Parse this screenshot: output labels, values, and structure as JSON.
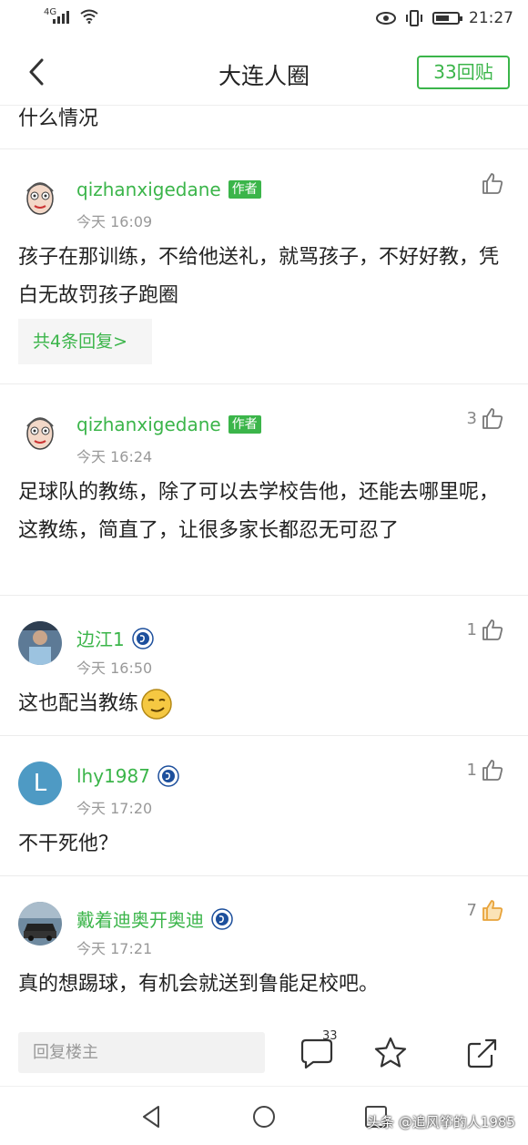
{
  "status_bar": {
    "network": "4G",
    "time": "21:27"
  },
  "header": {
    "title": "大连人圈",
    "reply_count_label": "33回贴"
  },
  "post": {
    "text_tail": "什么情况"
  },
  "comments": [
    {
      "username": "qizhanxigedane",
      "author_tag": "作者",
      "time": "今天 16:09",
      "likes": "",
      "text": "孩子在那训练，不给他送礼，就骂孩子，不好好教，凭白无故罚孩子跑圈",
      "replies_label": "共4条回复>"
    },
    {
      "username": "qizhanxigedane",
      "author_tag": "作者",
      "time": "今天 16:24",
      "likes": "3",
      "text": "足球队的教练，除了可以去学校告他，还能去哪里呢，这教练，简直了，让很多家长都忍无可忍了"
    },
    {
      "username": "边江1",
      "time": "今天 16:50",
      "likes": "1",
      "text": "这也配当教练"
    },
    {
      "username": "lhy1987",
      "avatar_letter": "L",
      "time": "今天 17:20",
      "likes": "1",
      "text": "不干死他？"
    },
    {
      "username": "戴着迪奥开奥迪",
      "time": "今天 17:21",
      "likes": "7",
      "text": "真的想踢球，有机会就送到鲁能足校吧。"
    }
  ],
  "bottom_bar": {
    "reply_placeholder": "回复楼主",
    "comment_count": "33"
  },
  "watermark": "头条 @追风筝的人1985",
  "colors": {
    "accent": "#3bb54a",
    "like_active": "#e8a33a"
  },
  "icons": [
    "back-icon",
    "thumbs-up-icon",
    "club-badge-icon",
    "comment-icon",
    "star-icon",
    "share-icon",
    "nav-back-icon",
    "nav-home-icon",
    "nav-recent-icon"
  ]
}
